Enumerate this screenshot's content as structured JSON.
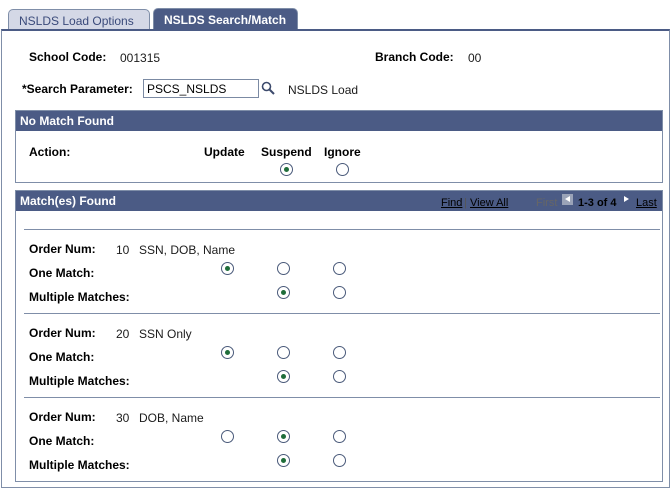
{
  "tabs": [
    {
      "label": "NSLDS Load Options"
    },
    {
      "label": "NSLDS Search/Match"
    }
  ],
  "header": {
    "school_code_label": "School Code:",
    "school_code_value": "001315",
    "branch_code_label": "Branch Code:",
    "branch_code_value": "00",
    "search_param_label": "*Search Parameter:",
    "search_param_value": "PSCS_NSLDS",
    "search_param_desc": "NSLDS Load"
  },
  "no_match": {
    "title": "No Match Found",
    "action_label": "Action:",
    "columns": [
      "Update",
      "Suspend",
      "Ignore"
    ],
    "selected": "Suspend"
  },
  "matches": {
    "title": "Match(es) Found",
    "nav": {
      "find": "Find",
      "separator": "|",
      "view_all": "View All",
      "first": "First",
      "range": "1-3 of 4",
      "last": "Last"
    },
    "order_label": "Order Num:",
    "one_match_label": "One Match:",
    "multiple_label": "Multiple Matches:",
    "rows": [
      {
        "order": "10",
        "desc": "SSN, DOB, Name",
        "one_match": "Update",
        "multiple": "Suspend"
      },
      {
        "order": "20",
        "desc": "SSN Only",
        "one_match": "Update",
        "multiple": "Suspend"
      },
      {
        "order": "30",
        "desc": "DOB, Name",
        "one_match": "Suspend",
        "multiple": "Suspend"
      }
    ]
  },
  "colors": {
    "header_bg": "#4b5b85",
    "border": "#7f8ea8",
    "radio_dot": "#1f6d3a"
  }
}
